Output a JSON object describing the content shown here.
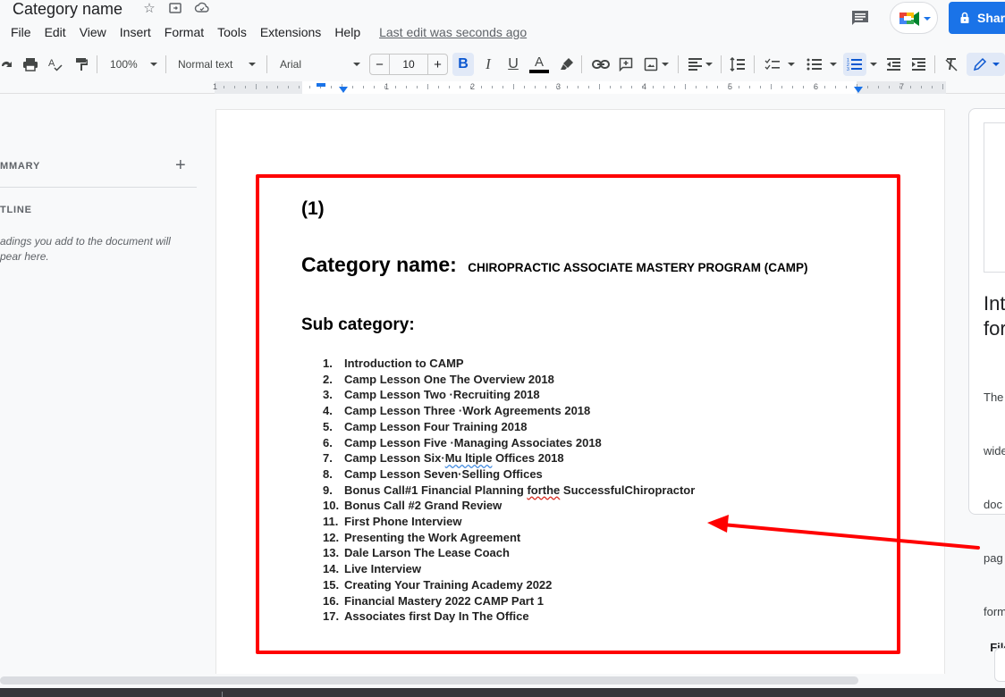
{
  "header": {
    "doc_title": "Category name",
    "icons": [
      "star-icon",
      "move-to-folder-icon",
      "cloud-saved-icon"
    ],
    "menu": [
      "File",
      "Edit",
      "View",
      "Insert",
      "Format",
      "Tools",
      "Extensions",
      "Help"
    ],
    "last_edit": "Last edit was seconds ago",
    "share_label": "Share",
    "share_visible_label": "Shar"
  },
  "toolbar": {
    "zoom": "100%",
    "style": "Normal text",
    "font": "Arial",
    "font_size": "10",
    "minus": "−",
    "plus": "+",
    "bold": "B",
    "italic": "I",
    "underline": "U",
    "text_color": "A",
    "text_color_value": "#000000"
  },
  "ruler": {
    "numbers": [
      "1",
      "1",
      "2",
      "3",
      "4",
      "5",
      "6",
      "7"
    ]
  },
  "sidebar": {
    "summary_heading": "MMARY",
    "outline_heading": "TLINE",
    "outline_note_line1": "adings you add to the document will",
    "outline_note_line2": "pear here.",
    "add_label": "+"
  },
  "document": {
    "number": "(1)",
    "category_label": "Category name:",
    "category_value": "CHIROPRACTIC ASSOCIATE MASTERY PROGRAM (CAMP)",
    "sub_label": "Sub category:",
    "items": [
      {
        "num": "1.",
        "text": "Introduction to CAMP"
      },
      {
        "num": "2.",
        "text": "Camp Lesson One The Overview 2018"
      },
      {
        "num": "3.",
        "text": "Camp Lesson Two ·Recruiting 2018"
      },
      {
        "num": "4.",
        "text": "Camp Lesson Three ·Work Agreements 2018"
      },
      {
        "num": "5.",
        "text": "Camp Lesson Four Training 2018"
      },
      {
        "num": "6.",
        "text": "Camp Lesson Five ·Managing Associates 2018"
      },
      {
        "num": "7.",
        "text_pre": "Camp Lesson Six·",
        "text_flag": "Mu ltiple",
        "text_post": " Offices 2018"
      },
      {
        "num": "8.",
        "text": "Camp Lesson Seven·Selling Offices"
      },
      {
        "num": "9.",
        "text_pre": "Bonus Call#1 Financial Planning ",
        "text_flag": "forthe",
        "text_post": " SuccessfulChiropractor"
      },
      {
        "num": "10.",
        "text": "Bonus Call #2 Grand Review"
      },
      {
        "num": "11.",
        "text": "First Phone Interview"
      },
      {
        "num": "12.",
        "text": "Presenting the Work Agreement"
      },
      {
        "num": "13.",
        "text": "Dale Larson The Lease Coach"
      },
      {
        "num": "14.",
        "text": "Live Interview"
      },
      {
        "num": "15.",
        "text": "Creating Your Training Academy 2022"
      },
      {
        "num": "16.",
        "text": "Financial Mastery 2022 CAMP Part 1"
      },
      {
        "num": "17.",
        "text": "Associates first Day In The Office"
      }
    ]
  },
  "right_panel": {
    "title": "Int\nfor",
    "body_lines": [
      "The",
      "wide",
      "doc",
      "pag",
      "form"
    ],
    "body_bold": "File"
  },
  "annotation": {
    "color": "#ff0000"
  }
}
